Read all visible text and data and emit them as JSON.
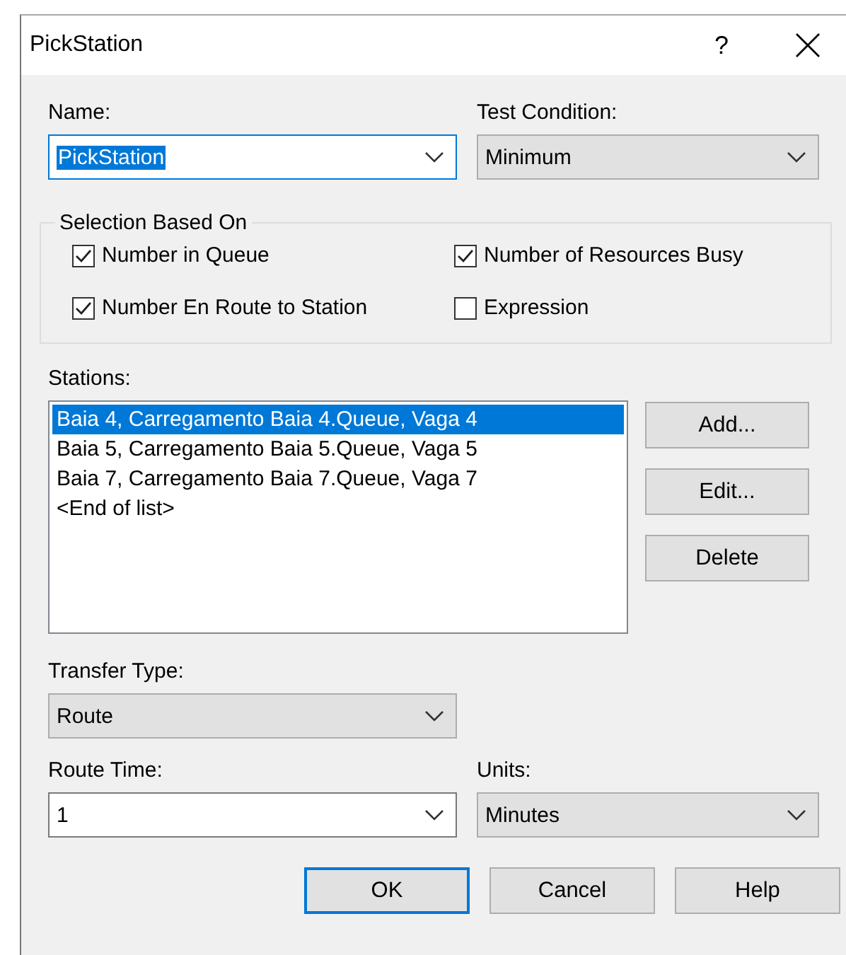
{
  "window": {
    "title": "PickStation",
    "help": "?"
  },
  "fields_top": [
    {
      "label": "Name:",
      "value": "PickStation",
      "kind": "editable",
      "focused": true
    },
    {
      "label": "Test Condition:",
      "value": "Minimum",
      "kind": "dropdown",
      "focused": false
    }
  ],
  "selection": {
    "title": "Selection Based On",
    "options": [
      {
        "label": "Number in Queue",
        "checked": true
      },
      {
        "label": "Number of Resources Busy",
        "checked": true
      },
      {
        "label": "Number En Route to Station",
        "checked": true
      },
      {
        "label": "Expression",
        "checked": false
      }
    ]
  },
  "stations": {
    "label": "Stations:",
    "items": [
      {
        "text": "Baia 4, Carregamento Baia 4.Queue, Vaga 4",
        "selected": true
      },
      {
        "text": "Baia 5, Carregamento Baia 5.Queue, Vaga 5",
        "selected": false
      },
      {
        "text": "Baia 7, Carregamento Baia 7.Queue, Vaga 7",
        "selected": false
      },
      {
        "text": "<End of list>",
        "selected": false
      }
    ],
    "buttons": [
      "Add...",
      "Edit...",
      "Delete"
    ]
  },
  "transfer_type": {
    "label": "Transfer Type:",
    "value": "Route",
    "kind": "dropdown",
    "focused": false
  },
  "fields_bottom": [
    {
      "label": "Route Time:",
      "value": "1",
      "kind": "editable",
      "focused": false
    },
    {
      "label": "Units:",
      "value": "Minutes",
      "kind": "dropdown",
      "focused": false
    }
  ],
  "buttons": [
    {
      "label": "OK",
      "default": true
    },
    {
      "label": "Cancel",
      "default": false
    },
    {
      "label": "Help",
      "default": false
    }
  ]
}
